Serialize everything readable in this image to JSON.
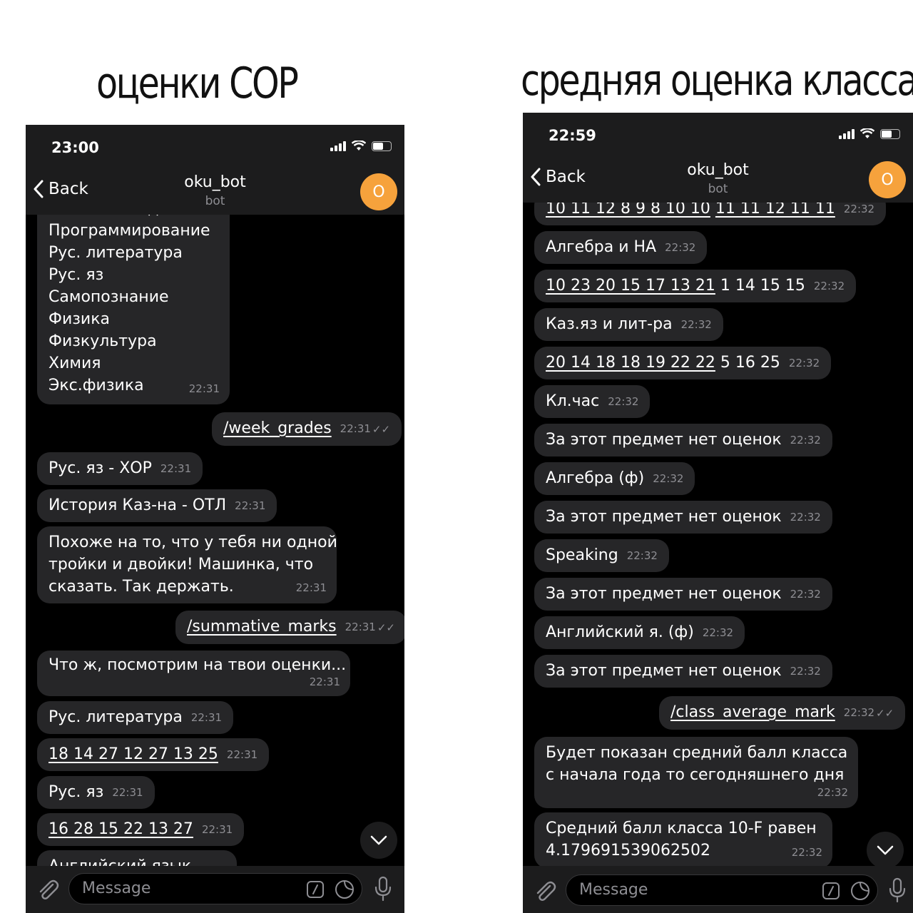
{
  "headings": {
    "left": "оценки СОР",
    "right": "средняя оценка класса"
  },
  "colors": {
    "background": "#000000",
    "bar": "#1c1c1d",
    "bubble": "#262628",
    "avatar": "#f6a23c"
  },
  "left_phone": {
    "time": "23:00",
    "back": "Back",
    "title": "oku_bot",
    "subtitle": "bot",
    "avatar_letter": "O",
    "subject_list": [
      "Нач.воен.подготовка",
      "Программирование",
      "Рус. литература",
      "Рус. яз",
      "Самопознание",
      "Физика",
      "Физкультура",
      "Химия",
      "Экс.физика"
    ],
    "subject_list_time": "22:31",
    "cmd1": "/week_grades",
    "cmd1_time": "22:31",
    "m1": "Рус. яз - ХОР",
    "m1_time": "22:31",
    "m2": "История Каз-на - ОТЛ",
    "m2_time": "22:31",
    "m3_l1": "Похоже на то, что у тебя ни одной",
    "m3_l2": "тройки и двойки! Машинка, что",
    "m3_l3": "сказать. Так держать.",
    "m3_time": "22:31",
    "cmd2": "/summative_marks",
    "cmd2_time": "22:31",
    "m4": "Что ж, посмотрим на твои оценки...",
    "m4_time": "22:31",
    "m5": "Рус. литература",
    "m5_time": "22:31",
    "m6": "18 14 27 12 27 13 25",
    "m6_time": "22:31",
    "m7": "Рус. яз",
    "m7_time": "22:31",
    "m8": "16 28 15 22 13 27",
    "m8_time": "22:31",
    "m9": "Английский язык",
    "input_placeholder": "Message"
  },
  "right_phone": {
    "time": "22:59",
    "back": "Back",
    "title": "oku_bot",
    "subtitle": "bot",
    "avatar_letter": "O",
    "r0_ul1": "10 11 12 8 9 8 10 10",
    "r0_ul2": "11 11 12 11 11",
    "r0_time": "22:32",
    "r1": "Алгебра и НА",
    "r1_time": "22:32",
    "r2_ul": "10 23 20 15 17 13 21",
    "r2_rest": "1 14 15 15",
    "r2_time": "22:32",
    "r3": "Каз.яз и лит-ра",
    "r3_time": "22:32",
    "r4_ul": "20 14 18 18 19 22 22",
    "r4_rest": "5 16 25",
    "r4_time": "22:32",
    "r5": "Кл.час",
    "r5_time": "22:32",
    "r6": "За этот предмет нет оценок",
    "r6_time": "22:32",
    "r7": "Алгебра (ф)",
    "r7_time": "22:32",
    "r8": "За этот предмет нет оценок",
    "r8_time": "22:32",
    "r9": "Speaking",
    "r9_time": "22:32",
    "r10": "За этот предмет нет оценок",
    "r10_time": "22:32",
    "r11": "Английский я. (ф)",
    "r11_time": "22:32",
    "r12": "За этот предмет нет оценок",
    "r12_time": "22:32",
    "cmd": "/class_average_mark",
    "cmd_time": "22:32",
    "r13_l1": "Будет показан средний балл класса",
    "r13_l2": "с начала года то сегодняшнего дня",
    "r13_time": "22:32",
    "r14_l1": "Средний балл класса 10-F равен",
    "r14_l2": "4.179691539062502",
    "r14_time": "22:32",
    "input_placeholder": "Message"
  }
}
